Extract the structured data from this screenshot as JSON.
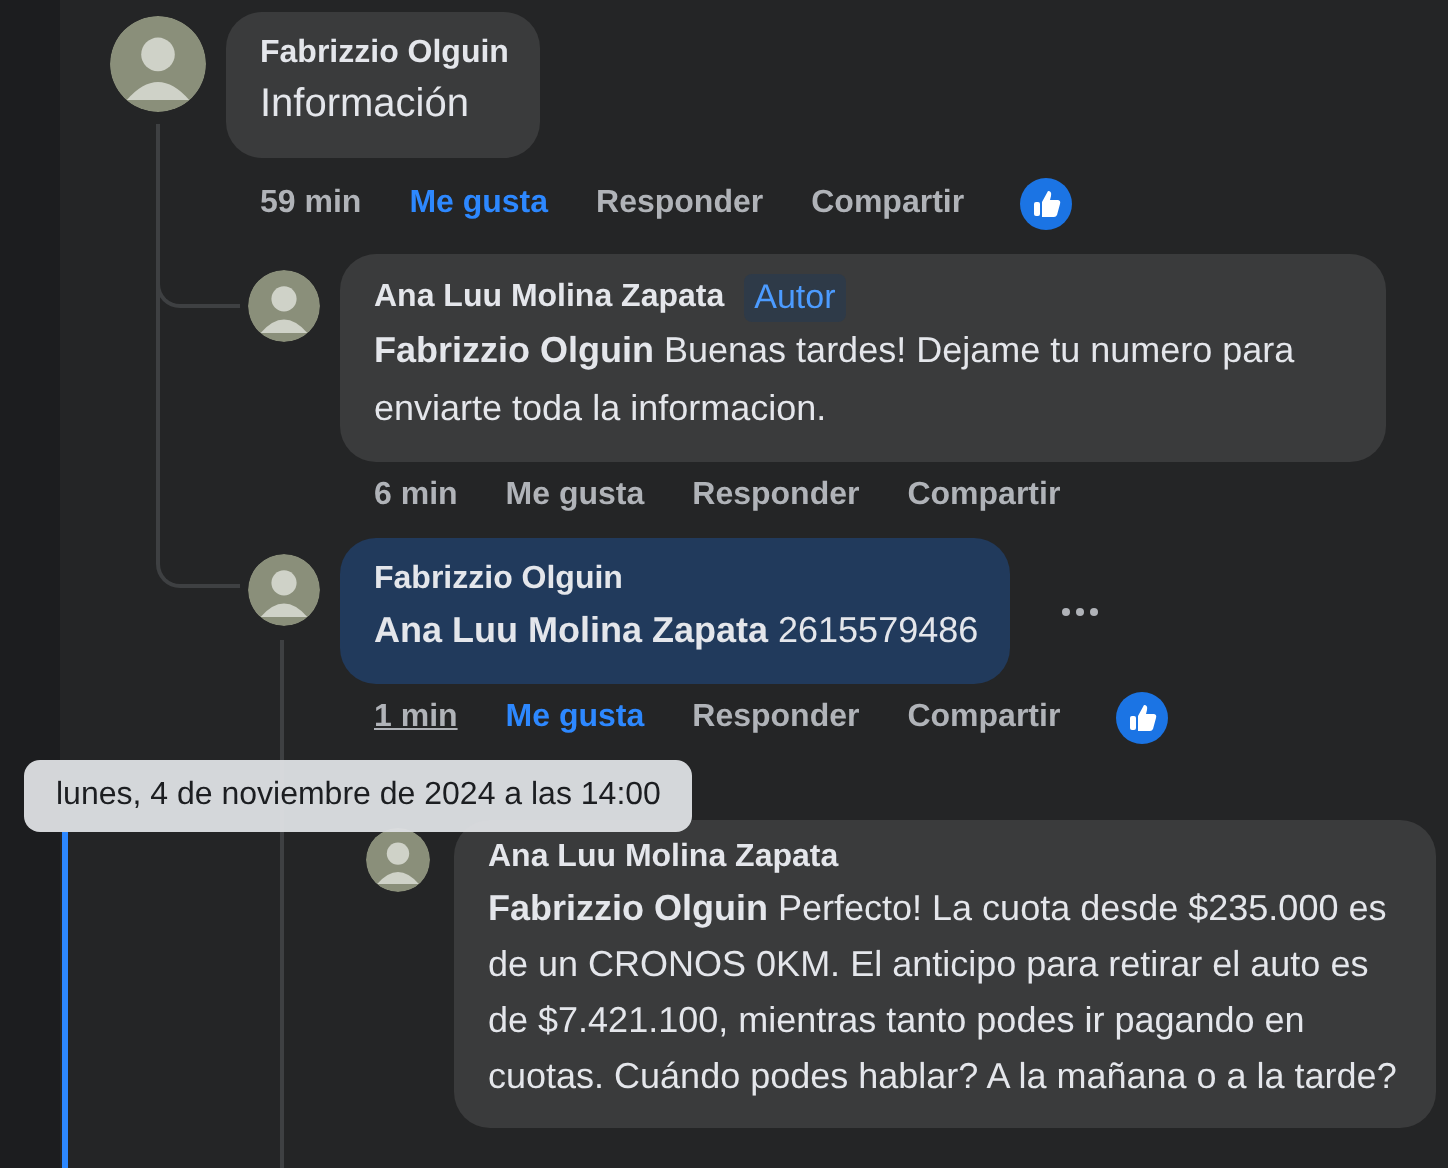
{
  "comments": [
    {
      "author": "Fabrizzio Olguin",
      "text": "Información",
      "highlighted": false,
      "actions": {
        "time": "59 min",
        "time_hovered": false,
        "like": "Me gusta",
        "liked": true,
        "reply": "Responder",
        "share": "Compartir",
        "reacted": true
      },
      "children": [
        {
          "author": "Ana Luu Molina Zapata",
          "badge": "Autor",
          "text": "**Fabrizzio Olguin** Buenas tardes! Dejame tu numero para enviarte toda la informacion.",
          "highlighted": false,
          "actions": {
            "time": "6 min",
            "time_hovered": false,
            "like": "Me gusta",
            "liked": false,
            "reply": "Responder",
            "share": "Compartir",
            "reacted": false
          }
        },
        {
          "author": "Fabrizzio Olguin",
          "text": "**Ana Luu Molina Zapata** 2615579486",
          "highlighted": true,
          "show_options": true,
          "actions": {
            "time": "1 min",
            "time_hovered": true,
            "like": "Me gusta",
            "liked": true,
            "reply": "Responder",
            "share": "Compartir",
            "reacted": true
          },
          "children": [
            {
              "author": "Ana Luu Molina Zapata",
              "text": "**Fabrizzio Olguin** Perfecto! La cuota desde $235.000 es de un CRONOS 0KM. El anticipo para retirar el auto es de $7.421.100, mientras tanto podes ir pagando en cuotas. Cuándo podes hablar? A la mañana o a la tarde?",
              "highlighted": false
            }
          ]
        }
      ]
    }
  ],
  "tooltip": {
    "text": "lunes, 4 de noviembre de 2024 a las 14:00"
  }
}
